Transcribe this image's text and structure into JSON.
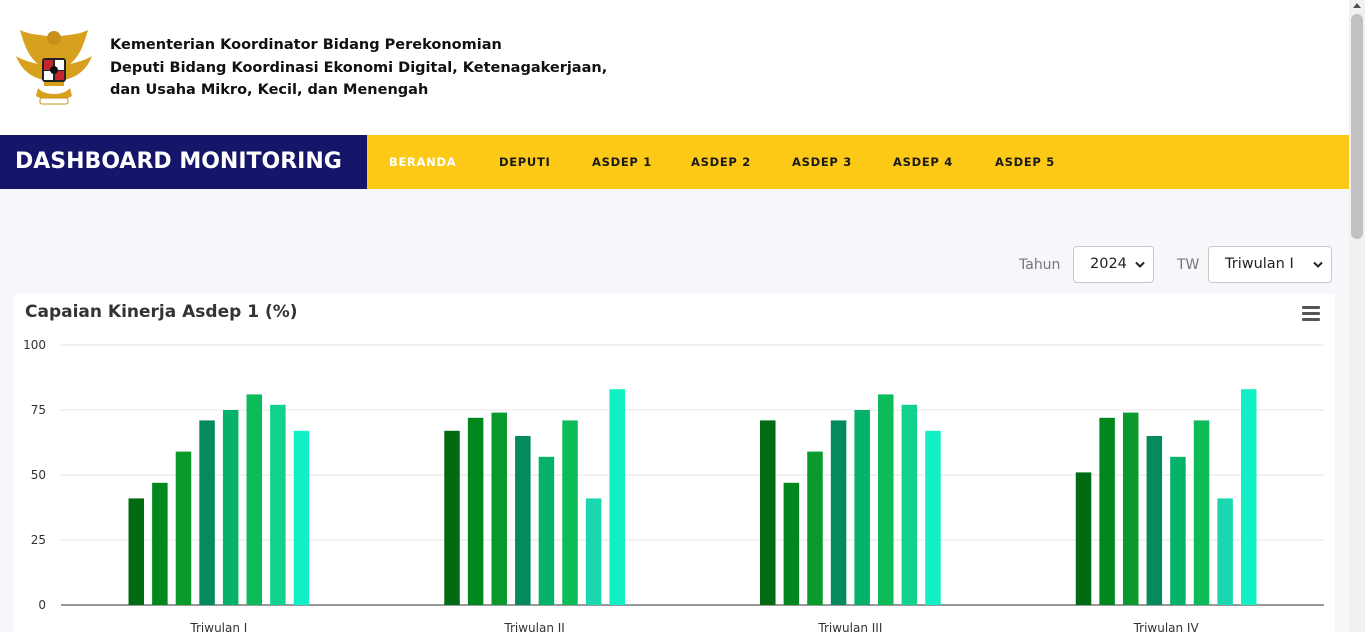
{
  "header": {
    "org_lines": [
      "Kementerian Koordinator Bidang Perekonomian",
      "Deputi Bidang Koordinasi Ekonomi Digital, Ketenagakerjaan,",
      "dan Usaha Mikro, Kecil, dan Menengah"
    ]
  },
  "navbar": {
    "brand": "DASHBOARD MONITORING",
    "items": [
      {
        "label": "BERANDA",
        "active": true
      },
      {
        "label": "DEPUTI",
        "active": false
      },
      {
        "label": "ASDEP 1",
        "active": false
      },
      {
        "label": "ASDEP 2",
        "active": false
      },
      {
        "label": "ASDEP 3",
        "active": false
      },
      {
        "label": "ASDEP 4",
        "active": false
      },
      {
        "label": "ASDEP 5",
        "active": false
      }
    ],
    "colors": {
      "bar": "#fcc917",
      "brand_bg": "#15166a"
    }
  },
  "filters": {
    "year_label": "Tahun",
    "year_value": "2024",
    "tw_label": "TW",
    "tw_value": "Triwulan I"
  },
  "card": {
    "title": "Capaian Kinerja Asdep 1 (%)",
    "menu_icon": "hamburger-menu-icon"
  },
  "chart_data": {
    "type": "bar",
    "categories": [
      "Triwulan I",
      "Triwulan II",
      "Triwulan III",
      "Triwulan IV"
    ],
    "ylim": [
      0,
      100
    ],
    "yticks": [
      0,
      25,
      50,
      75,
      100
    ],
    "grid": true,
    "series_colors": [
      "#006b12",
      "#00881f",
      "#0a9a2c",
      "#048a5c",
      "#05b26a",
      "#0dbb59",
      "#10d28c",
      "#11f0c5"
    ],
    "series_colors_by_group": [
      [
        "#006b12",
        "#00881f",
        "#0a9a2c",
        "#048a5c",
        "#05b26a",
        "#0dbb59",
        "#10d28c",
        "#11f0c5"
      ],
      [
        "#006b12",
        "#00881f",
        "#0a9a2c",
        "#048a5c",
        "#05b26a",
        "#0dbb59",
        "#1ad7b0",
        "#11f0c5"
      ],
      [
        "#006b12",
        "#00881f",
        "#0a9a2c",
        "#048a5c",
        "#05b26a",
        "#0dbb59",
        "#10d28c",
        "#11f0c5"
      ],
      [
        "#006b12",
        "#00881f",
        "#0a9a2c",
        "#048a5c",
        "#05b26a",
        "#0dbb59",
        "#1ad7b0",
        "#11f0c5"
      ]
    ],
    "groups": [
      [
        41,
        47,
        59,
        71,
        75,
        81,
        77,
        67
      ],
      [
        67,
        72,
        74,
        65,
        57,
        71,
        41,
        83
      ],
      [
        71,
        47,
        59,
        71,
        75,
        81,
        77,
        67
      ],
      [
        51,
        72,
        74,
        65,
        57,
        71,
        41,
        83
      ]
    ]
  }
}
